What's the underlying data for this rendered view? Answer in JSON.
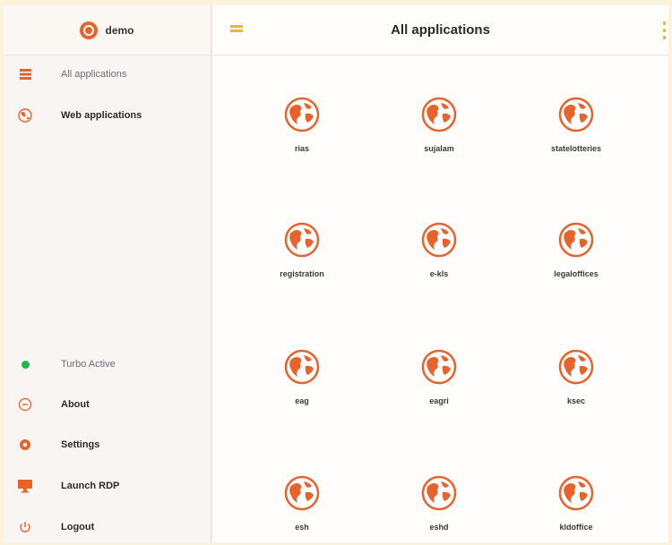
{
  "brand": {
    "name": "demo"
  },
  "header": {
    "title": "All applications",
    "menu_icon": "menu-icon",
    "more_icon": "kebab-icon"
  },
  "sidebar": {
    "nav": [
      {
        "label": "All applications",
        "icon": "grid-icon"
      },
      {
        "label": "Web applications",
        "icon": "globe-icon"
      }
    ],
    "footer": [
      {
        "label": "Turbo Active",
        "icon": "status-dot-icon"
      },
      {
        "label": "About",
        "icon": "info-icon"
      },
      {
        "label": "Settings",
        "icon": "gear-icon"
      },
      {
        "label": "Launch RDP",
        "icon": "monitor-icon"
      },
      {
        "label": "Logout",
        "icon": "power-icon"
      }
    ]
  },
  "apps": [
    {
      "label": "rias"
    },
    {
      "label": "sujalam"
    },
    {
      "label": "statelotteries"
    },
    {
      "label": "registration"
    },
    {
      "label": "e-kls"
    },
    {
      "label": "legaloffices"
    },
    {
      "label": "eag"
    },
    {
      "label": "eagri"
    },
    {
      "label": "ksec"
    },
    {
      "label": "esh"
    },
    {
      "label": "eshd"
    },
    {
      "label": "kldoffice"
    }
  ],
  "colors": {
    "accent": "#e8622b",
    "menu": "#e5b53d",
    "status_active": "#1fb64e"
  }
}
